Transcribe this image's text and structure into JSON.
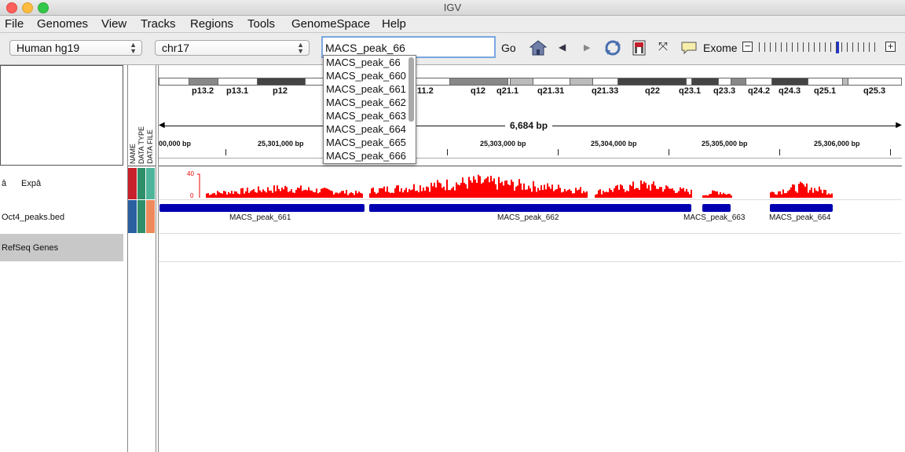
{
  "window": {
    "title": "IGV"
  },
  "menus": [
    "File",
    "Genomes",
    "View",
    "Tracks",
    "Regions",
    "Tools",
    "GenomeSpace",
    "Help"
  ],
  "toolbar": {
    "genome": "Human hg19",
    "chromosome": "chr17",
    "locus": "MACS_peak_66",
    "go_label": "Go",
    "exome_label": "Exome",
    "zoom_minus": "−",
    "zoom_plus": "+"
  },
  "autocomplete": {
    "items": [
      "MACS_peak_66",
      "MACS_peak_660",
      "MACS_peak_661",
      "MACS_peak_662",
      "MACS_peak_663",
      "MACS_peak_664",
      "MACS_peak_665",
      "MACS_peak_666"
    ]
  },
  "ideogram": {
    "band_labels": [
      "p13.2",
      "p13.1",
      "p12",
      "11.2",
      "q12",
      "q21.1",
      "q21.31",
      "q21.33",
      "q22",
      "q23.1",
      "q23.3",
      "q24.2",
      "q24.3",
      "q25.1",
      "q25.3"
    ]
  },
  "ruler": {
    "span": "6,684 bp",
    "ticks": [
      "00,000 bp",
      "25,301,000 bp",
      "25,303,000 bp",
      "25,304,000 bp",
      "25,305,000 bp",
      "25,306,000 bp"
    ]
  },
  "attribute_headers": [
    "NAME",
    "DATA TYPE",
    "DATA FILE"
  ],
  "tracks": [
    {
      "name_prefix": "â",
      "name": "Expâ"
    },
    {
      "name": "Oct4_peaks.bed"
    },
    {
      "name": "RefSeq Genes"
    }
  ],
  "coverage": {
    "scale_max": "40",
    "scale_min": "0",
    "color": "#ff0000"
  },
  "peaks": [
    {
      "label": "MACS_peak_661"
    },
    {
      "label": "MACS_peak_662"
    },
    {
      "label": "MACS_peak_663"
    },
    {
      "label": "MACS_peak_664"
    }
  ],
  "colors": {
    "peak": "#0000b0",
    "coverage": "#ff0000",
    "attr_name": "#c8202a",
    "attr_type": "#2f8f6a",
    "attr_file": "#4fb59a"
  }
}
